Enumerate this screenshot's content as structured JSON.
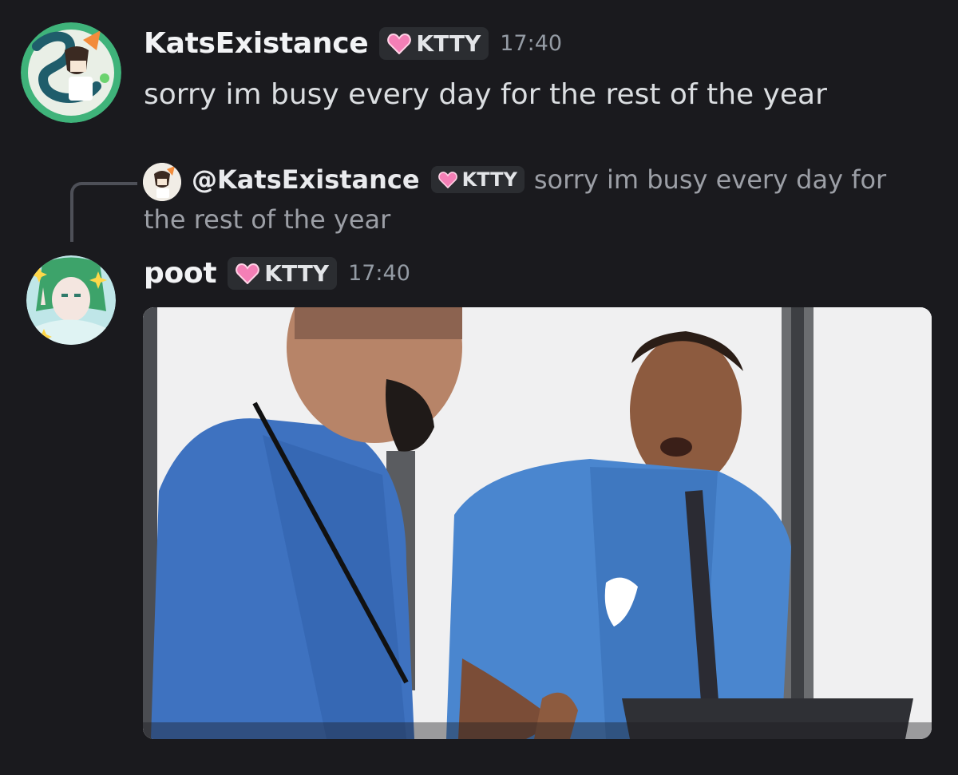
{
  "messages": [
    {
      "username": "KatsExistance",
      "tag": "KTTY",
      "time": "17:40",
      "text": "sorry im busy every day for the rest of the year"
    },
    {
      "reply": {
        "username": "@KatsExistance",
        "tag": "KTTY",
        "text_line1": "sorry im busy every day for",
        "text_line2": "the rest of the year"
      },
      "username": "poot",
      "tag": "KTTY",
      "time": "17:40",
      "attachment": "gif"
    }
  ],
  "colors": {
    "background": "#1a1a1e",
    "tag_background": "#2b2d31",
    "heart": "#f47fb6",
    "muted_text": "#949ba4"
  }
}
